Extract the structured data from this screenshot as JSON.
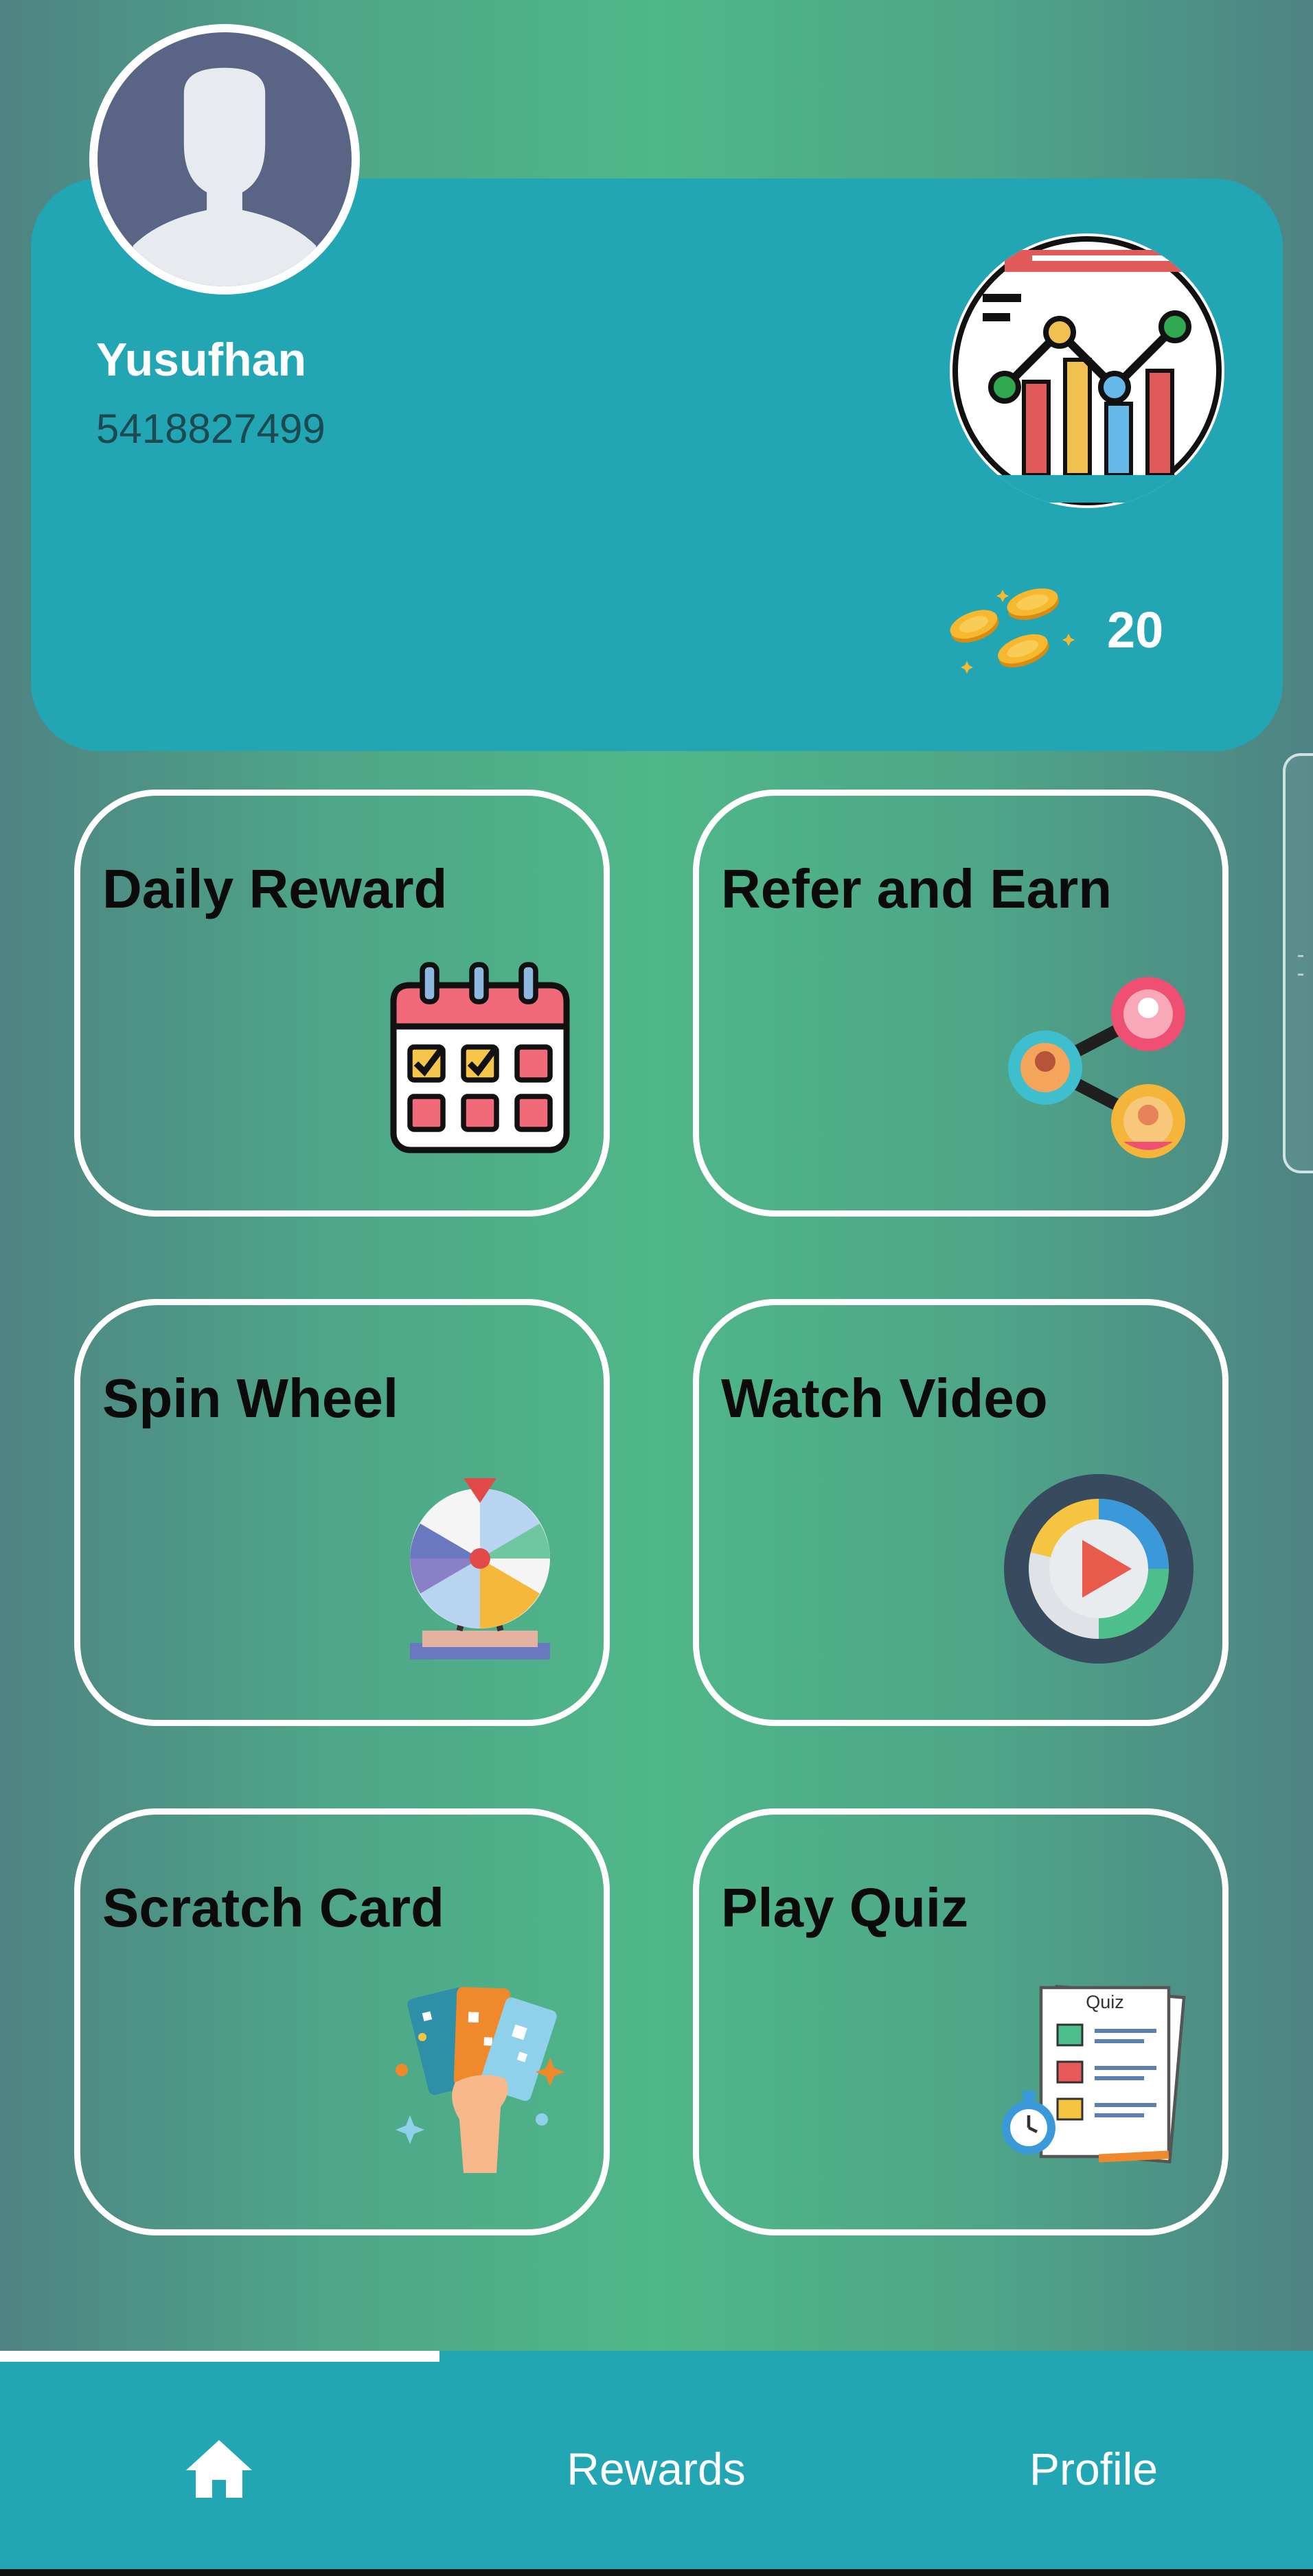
{
  "profile": {
    "name": "Yusufhan",
    "phone": "5418827499",
    "coins": "20",
    "avatar_icon": "user-silhouette-icon",
    "stats_icon": "line-chart-icon",
    "coins_icon": "gold-coins-icon"
  },
  "tiles": [
    {
      "label": "Daily Reward",
      "icon": "calendar-check-icon"
    },
    {
      "label": "Refer and Earn",
      "icon": "referral-network-icon"
    },
    {
      "label": "Spin Wheel",
      "icon": "prize-wheel-icon"
    },
    {
      "label": "Watch Video",
      "icon": "play-video-icon"
    },
    {
      "label": "Scratch Card",
      "icon": "scratch-cards-icon"
    },
    {
      "label": "Play Quiz",
      "icon": "quiz-clipboard-icon"
    }
  ],
  "quiz_icon_text": "Quiz",
  "nav": {
    "home_icon": "home-icon",
    "rewards_label": "Rewards",
    "profile_label": "Profile",
    "active_tab": "home"
  },
  "colors": {
    "card": "#22a6b4",
    "nav": "#22a6b4",
    "background_center": "#4fb789",
    "background_edge": "#4e8383"
  }
}
